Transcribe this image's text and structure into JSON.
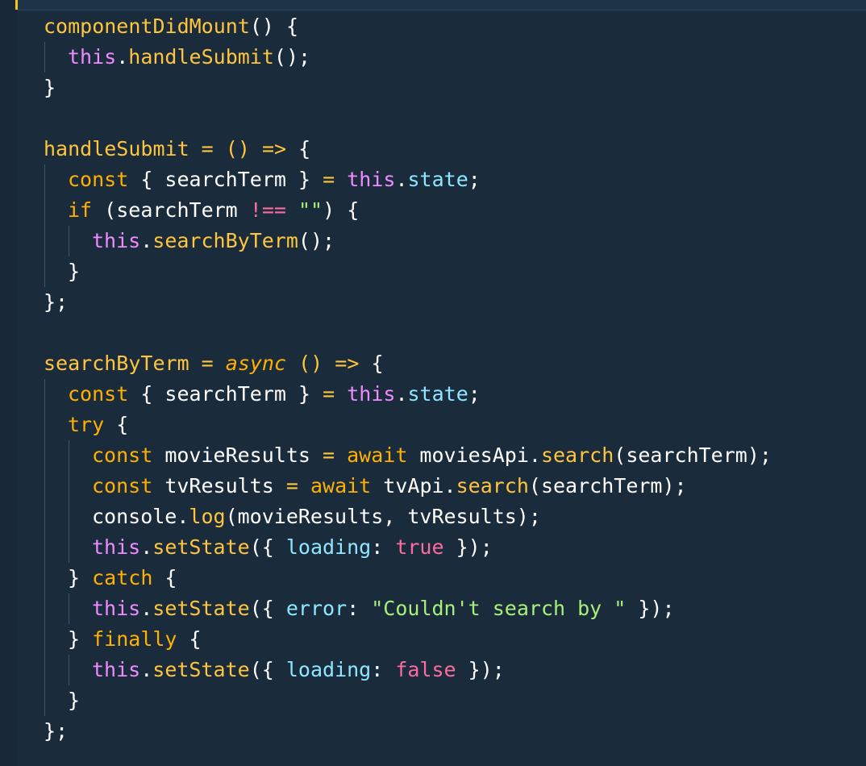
{
  "editor": {
    "lines": {
      "l1": [
        "componentDidMount",
        "() {"
      ],
      "l2": [
        "this",
        ".",
        "handleSubmit",
        "();"
      ],
      "l3": [
        "}"
      ],
      "l5": [
        "handleSubmit",
        " = ",
        "()",
        " => ",
        "{"
      ],
      "l6": [
        "const",
        " { searchTerm } ",
        "=",
        " ",
        "this",
        ".",
        "state",
        ";"
      ],
      "l7": [
        "if",
        " (searchTerm ",
        "!==",
        " ",
        "\"\"",
        ") {"
      ],
      "l8": [
        "this",
        ".",
        "searchByTerm",
        "();"
      ],
      "l9": [
        "}"
      ],
      "l10": [
        "};"
      ],
      "l12": [
        "searchByTerm",
        " = ",
        "async",
        " ",
        "()",
        " => ",
        "{"
      ],
      "l13": [
        "const",
        " { searchTerm } ",
        "=",
        " ",
        "this",
        ".",
        "state",
        ";"
      ],
      "l14": [
        "try",
        " {"
      ],
      "l15": [
        "const",
        " movieResults ",
        "=",
        " ",
        "await",
        " moviesApi.",
        "search",
        "(searchTerm);"
      ],
      "l16": [
        "const",
        " tvResults ",
        "=",
        " ",
        "await",
        " tvApi.",
        "search",
        "(searchTerm);"
      ],
      "l17": [
        "console.",
        "log",
        "(movieResults, tvResults);"
      ],
      "l18": [
        "this",
        ".",
        "setState",
        "({ ",
        "loading",
        ": ",
        "true",
        " });"
      ],
      "l19": [
        "} ",
        "catch",
        " {"
      ],
      "l20": [
        "this",
        ".",
        "setState",
        "({ ",
        "error",
        ": ",
        "\"Couldn't search by \"",
        " });"
      ],
      "l21": [
        "} ",
        "finally",
        " {"
      ],
      "l22": [
        "this",
        ".",
        "setState",
        "({ ",
        "loading",
        ": ",
        "false",
        " });"
      ],
      "l23": [
        "}"
      ],
      "l24": [
        "};"
      ]
    }
  },
  "colors": {
    "background": "#1a2b3c",
    "keyword": "#ffb000",
    "this": "#f08bff",
    "function": "#ffc53d",
    "property": "#8fe6ff",
    "string": "#a7f07a",
    "boolean": "#ff6b9d",
    "accent_marker": "#f5c518"
  }
}
